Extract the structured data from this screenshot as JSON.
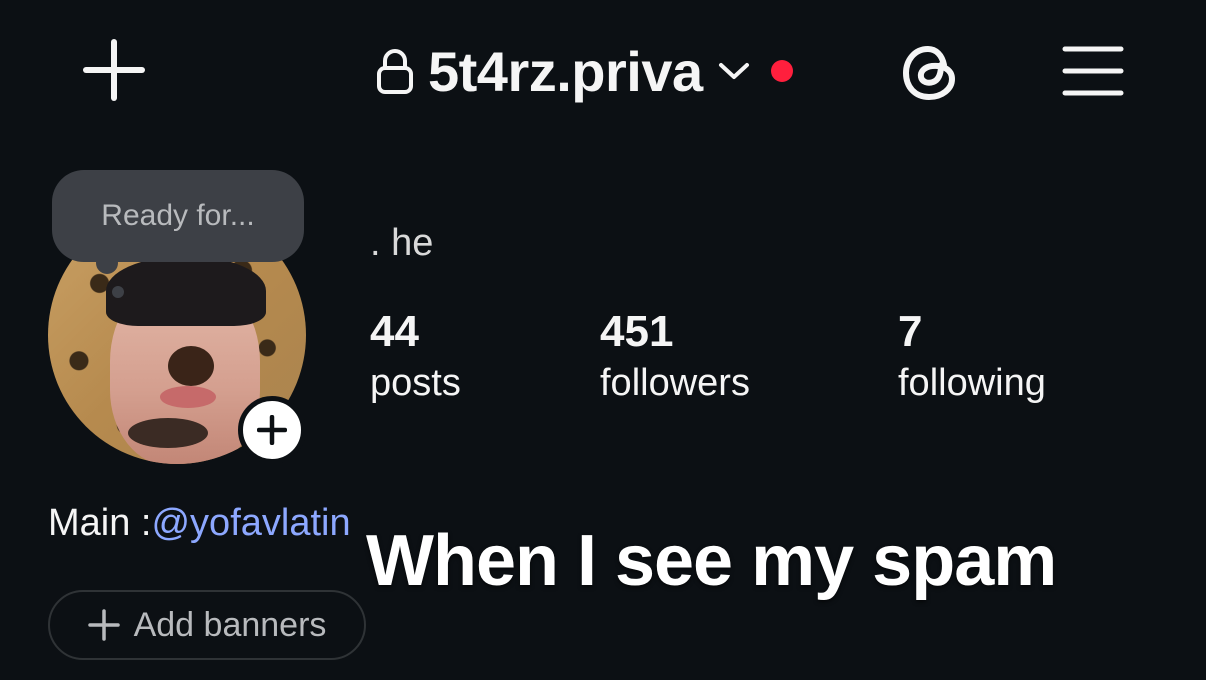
{
  "header": {
    "username": "5t4rz.priva",
    "add_icon": "plus-icon",
    "lock_icon": "lock-icon",
    "chevron_icon": "chevron-down-icon",
    "threads_icon": "threads-icon",
    "menu_icon": "hamburger-menu-icon",
    "notification_dot_color": "#ff1f3d"
  },
  "note": {
    "text": "Ready for..."
  },
  "profile": {
    "display_name": ". he",
    "stats": [
      {
        "value": "44",
        "label": "posts"
      },
      {
        "value": "451",
        "label": "followers"
      },
      {
        "value": "7",
        "label": "following"
      }
    ],
    "bio_prefix": "Main :",
    "bio_link": "@yofavlatin"
  },
  "overlay": {
    "caption": "When I see my spam"
  },
  "add_banners": {
    "label": "Add banners"
  },
  "colors": {
    "background": "#0c1014",
    "link": "#8da8ff",
    "bubble": "#3d4046"
  }
}
